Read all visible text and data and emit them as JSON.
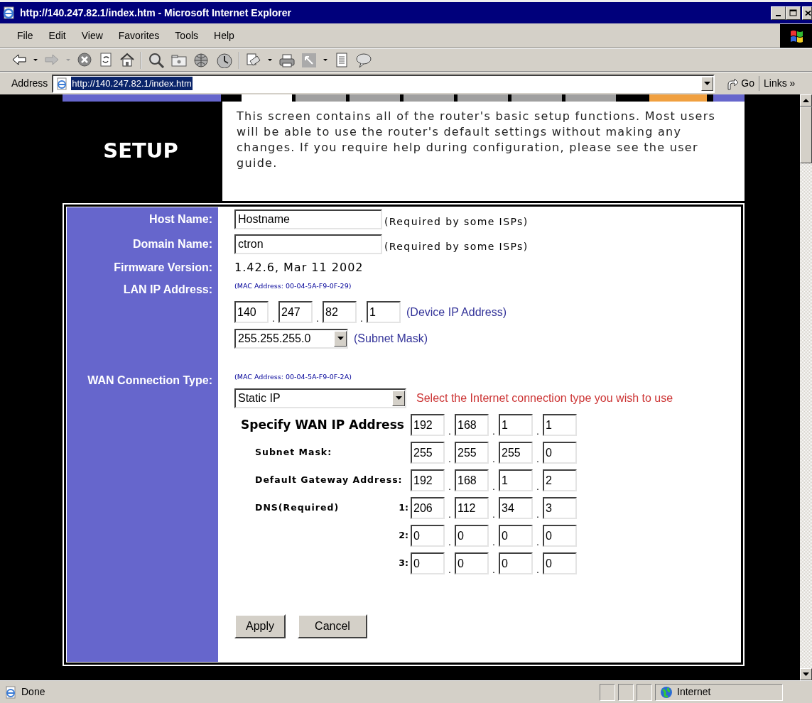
{
  "window": {
    "title": "http://140.247.82.1/index.htm - Microsoft Internet Explorer"
  },
  "menu": [
    "File",
    "Edit",
    "View",
    "Favorites",
    "Tools",
    "Help"
  ],
  "address_bar": {
    "label": "Address",
    "url": "http://140.247.82.1/index.htm",
    "go": "Go",
    "links": "Links",
    "links_more": "»"
  },
  "page": {
    "nav_tabs": [
      {
        "kind": "tab",
        "color": "#ffffff"
      },
      {
        "kind": "tab",
        "color": "#a0a0a0"
      },
      {
        "kind": "tab",
        "color": "#a0a0a0"
      },
      {
        "kind": "tab",
        "color": "#a0a0a0"
      },
      {
        "kind": "tab",
        "color": "#a0a0a0"
      },
      {
        "kind": "tab",
        "color": "#a0a0a0"
      },
      {
        "kind": "tab",
        "color": "#a0a0a0"
      },
      {
        "kind": "accent",
        "color": "#f0a040"
      },
      {
        "kind": "accent",
        "color": "#6666cc"
      }
    ],
    "header": {
      "title": "SETUP",
      "description": "This screen contains all of the router's basic setup functions. Most users will be able to use the router's default settings without making any changes. If you require help during configuration, please see the user guide."
    },
    "form": {
      "host_name": {
        "label": "Host Name:",
        "value": "Hostname",
        "note": "(Required by some ISPs)"
      },
      "domain_name": {
        "label": "Domain Name:",
        "value": "ctron",
        "note": "(Required by some ISPs)"
      },
      "firmware": {
        "label": "Firmware Version:",
        "value": "1.42.6, Mar 11 2002"
      },
      "lan": {
        "label": "LAN IP Address:",
        "mac": "(MAC Address: 00-04-5A-F9-0F-29)",
        "ip": {
          "octets": [
            "140",
            "247",
            "82",
            "1"
          ],
          "separators": [
            ".",
            ".",
            "."
          ]
        },
        "ip_note": "(Device IP Address)",
        "subnet": "255.255.255.0",
        "subnet_note": "(Subnet Mask)"
      },
      "wan": {
        "label": "WAN Connection Type:",
        "mac": "(MAC Address: 00-04-5A-F9-0F-2A)",
        "type": "Static IP",
        "hint": "Select the Internet connection type you wish to use",
        "rows": [
          {
            "kind": "heading",
            "label": "Specify WAN IP Address",
            "octets": [
              "192",
              "168",
              "1",
              "1"
            ],
            "separators": [
              ".",
              ".",
              "."
            ]
          },
          {
            "kind": "field",
            "label": "Subnet Mask:",
            "octets": [
              "255",
              "255",
              "255",
              "0"
            ],
            "separators": [
              ".",
              ".",
              "."
            ]
          },
          {
            "kind": "field",
            "label": "Default Gateway Address:",
            "octets": [
              "192",
              "168",
              "1",
              "2"
            ],
            "separators": [
              ".",
              ".",
              "."
            ]
          },
          {
            "kind": "field",
            "label": "DNS(Required)",
            "index": "1:",
            "octets": [
              "206",
              "112",
              "34",
              "3"
            ],
            "separators": [
              ".",
              ".",
              "."
            ]
          },
          {
            "kind": "field",
            "index": "2:",
            "octets": [
              "0",
              "0",
              "0",
              "0"
            ],
            "separators": [
              ".",
              ".",
              "."
            ]
          },
          {
            "kind": "field",
            "index": "3:",
            "octets": [
              "0",
              "0",
              "0",
              "0"
            ],
            "separators": [
              ".",
              ".",
              "."
            ]
          }
        ]
      },
      "buttons": [
        "Apply",
        "Cancel"
      ]
    }
  },
  "status_bar": {
    "text": "Done",
    "zone": "Internet"
  }
}
